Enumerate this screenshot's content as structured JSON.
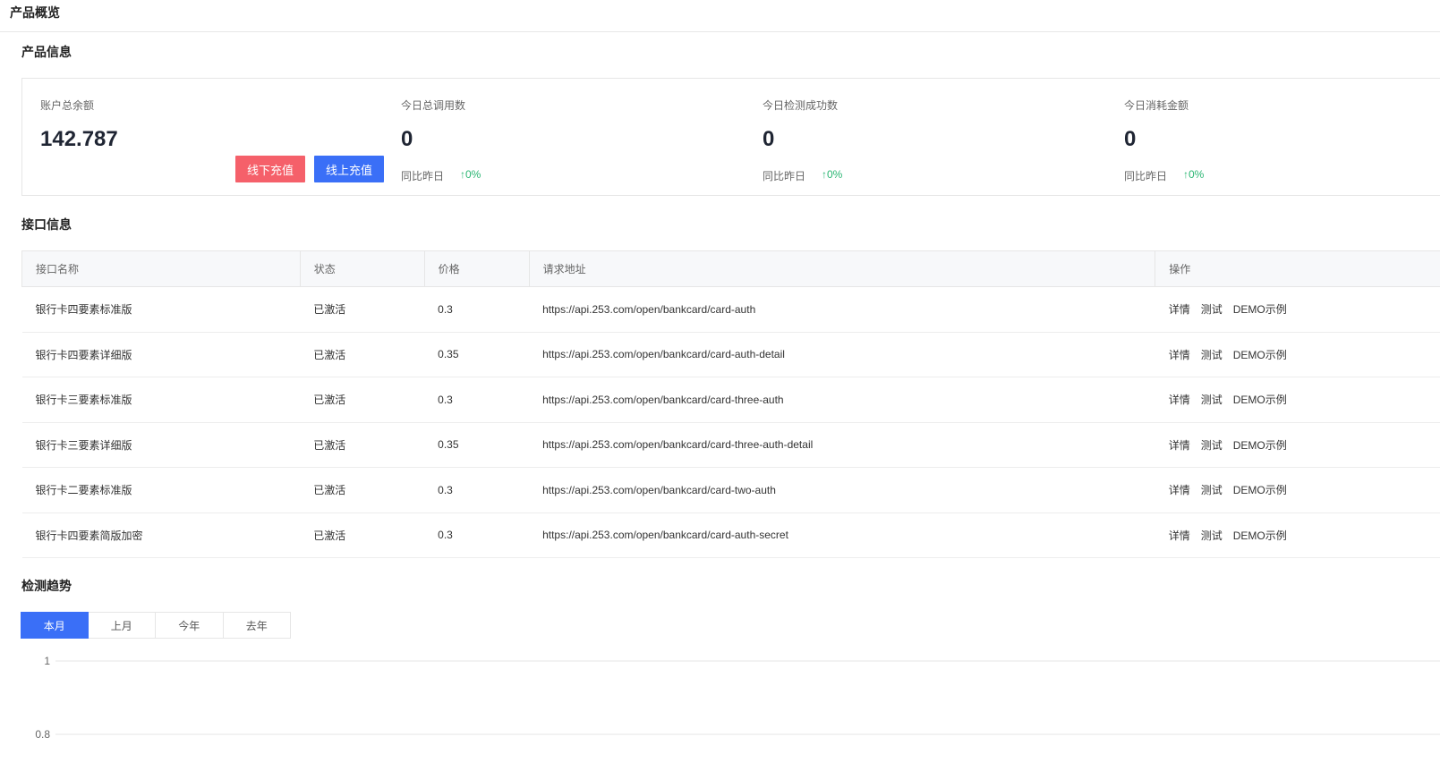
{
  "page": {
    "title": "产品概览"
  },
  "product_info": {
    "title": "产品信息",
    "balance": {
      "label": "账户总余额",
      "value": "142.787",
      "offline_btn": "线下充值",
      "online_btn": "线上充值"
    },
    "stats": [
      {
        "label": "今日总调用数",
        "value": "0",
        "compare": "同比昨日",
        "delta": "↑0%"
      },
      {
        "label": "今日检测成功数",
        "value": "0",
        "compare": "同比昨日",
        "delta": "↑0%"
      },
      {
        "label": "今日消耗金额",
        "value": "0",
        "compare": "同比昨日",
        "delta": "↑0%"
      }
    ]
  },
  "api_info": {
    "title": "接口信息",
    "columns": [
      "接口名称",
      "状态",
      "价格",
      "请求地址",
      "操作"
    ],
    "actions": [
      "详情",
      "测试",
      "DEMO示例"
    ],
    "rows": [
      {
        "name": "银行卡四要素标准版",
        "status": "已激活",
        "price": "0.3",
        "url": "https://api.253.com/open/bankcard/card-auth"
      },
      {
        "name": "银行卡四要素详细版",
        "status": "已激活",
        "price": "0.35",
        "url": "https://api.253.com/open/bankcard/card-auth-detail"
      },
      {
        "name": "银行卡三要素标准版",
        "status": "已激活",
        "price": "0.3",
        "url": "https://api.253.com/open/bankcard/card-three-auth"
      },
      {
        "name": "银行卡三要素详细版",
        "status": "已激活",
        "price": "0.35",
        "url": "https://api.253.com/open/bankcard/card-three-auth-detail"
      },
      {
        "name": "银行卡二要素标准版",
        "status": "已激活",
        "price": "0.3",
        "url": "https://api.253.com/open/bankcard/card-two-auth"
      },
      {
        "name": "银行卡四要素简版加密",
        "status": "已激活",
        "price": "0.3",
        "url": "https://api.253.com/open/bankcard/card-auth-secret"
      }
    ]
  },
  "trend": {
    "title": "检测趋势",
    "tabs": [
      "本月",
      "上月",
      "今年",
      "去年"
    ],
    "active_tab": 0
  },
  "chart_data": {
    "type": "line",
    "y_ticks": [
      "1",
      "0.8"
    ],
    "ylim": [
      0.8,
      1
    ],
    "grid": true,
    "series": []
  }
}
